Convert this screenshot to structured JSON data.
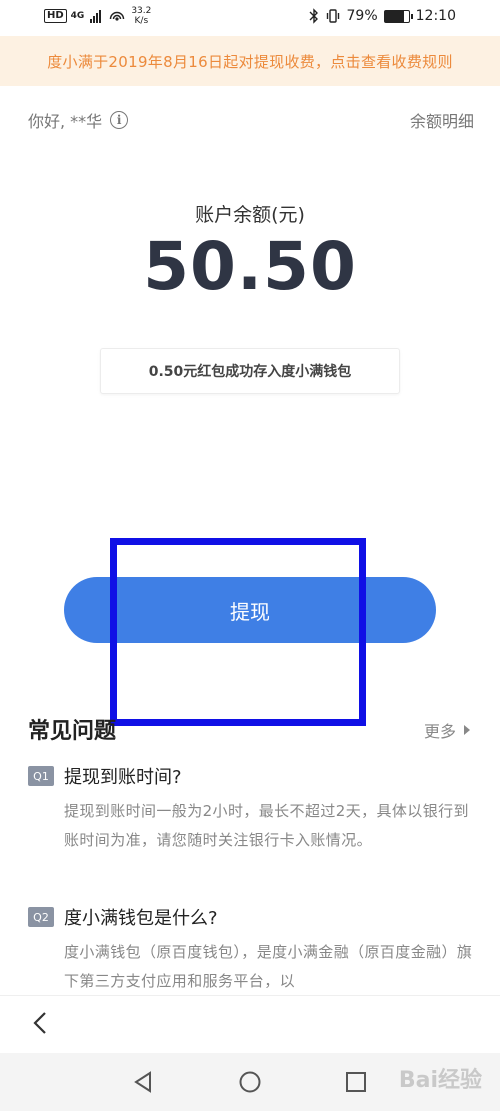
{
  "status_bar": {
    "hd": "HD",
    "network": "4G",
    "speed_value": "33.2",
    "speed_unit": "K/s",
    "battery_percent": "79%",
    "battery_level": 0.79,
    "time": "12:10"
  },
  "notice": {
    "text": "度小满于2019年8月16日起对提现收费，点击查看收费规则"
  },
  "header": {
    "greeting": "你好, **华",
    "balance_detail": "余额明细"
  },
  "balance": {
    "label": "账户余额(元)",
    "amount": "50.50"
  },
  "tip": {
    "text": "0.50元红包成功存入度小满钱包"
  },
  "withdraw": {
    "label": "提现"
  },
  "faq": {
    "title": "常见问题",
    "more": "更多",
    "items": [
      {
        "badge": "Q1",
        "question": "提现到账时间?",
        "answer": "提现到账时间一般为2小时，最长不超过2天，具体以银行到账时间为准，请您随时关注银行卡入账情况。"
      },
      {
        "badge": "Q2",
        "question": "度小满钱包是什么?",
        "answer": "度小满钱包（原百度钱包），是度小满金融（原百度金融）旗下第三方支付应用和服务平台，以"
      }
    ]
  },
  "colors": {
    "accent": "#3f7fe5",
    "notice_text": "#ec8a3c",
    "notice_bg": "#fdf1e2",
    "highlight": "#1010e6"
  },
  "watermark": "Bai经验"
}
